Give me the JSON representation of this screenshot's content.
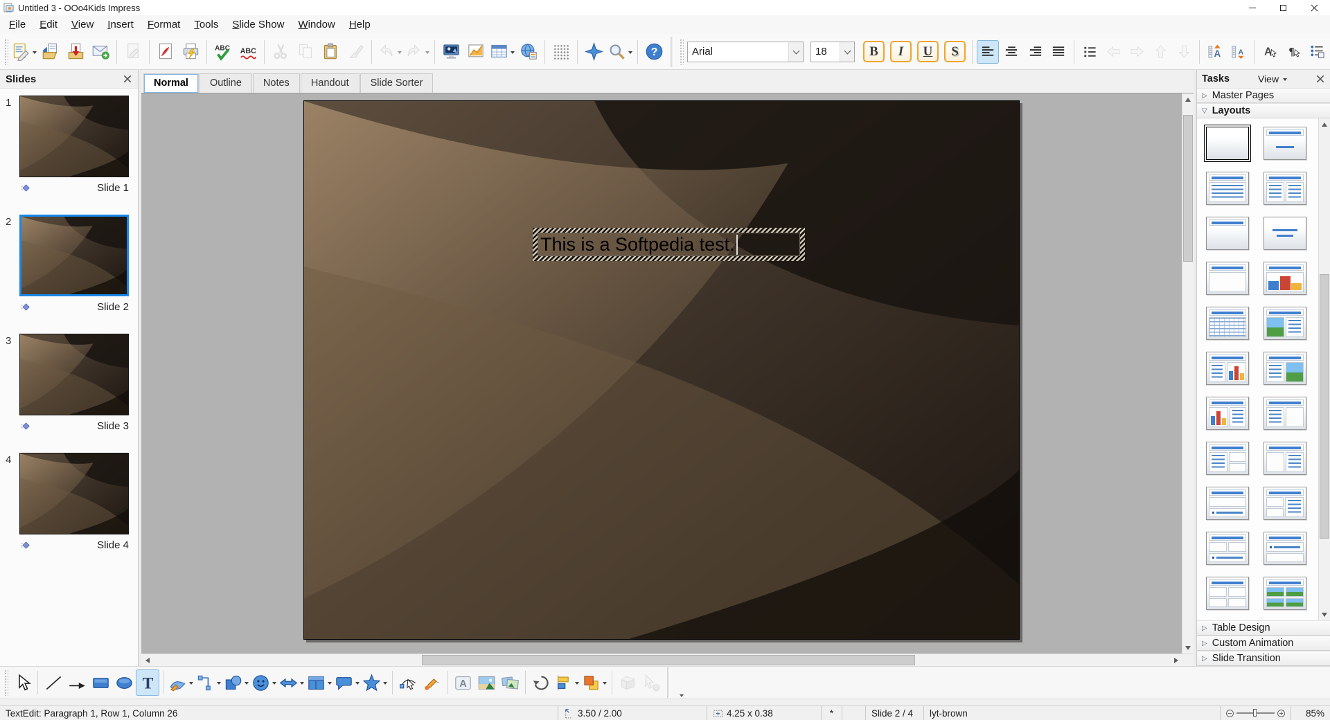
{
  "window": {
    "title": "Untitled 3 - OOo4Kids Impress"
  },
  "menu": {
    "items": [
      "File",
      "Edit",
      "View",
      "Insert",
      "Format",
      "Tools",
      "Slide Show",
      "Window",
      "Help"
    ]
  },
  "main_toolbar": {
    "buttons": [
      {
        "name": "new-presentation",
        "icon": "new-presentation",
        "dropdown": true
      },
      {
        "name": "open",
        "icon": "open"
      },
      {
        "name": "save",
        "icon": "save"
      },
      {
        "name": "send-email",
        "icon": "email"
      },
      {
        "sep": true
      },
      {
        "name": "edit-file",
        "icon": "edit-file",
        "disabled": true
      },
      {
        "sep": true
      },
      {
        "name": "export-pdf",
        "icon": "export-pdf"
      },
      {
        "name": "print",
        "icon": "print"
      },
      {
        "sep": true
      },
      {
        "name": "spellcheck",
        "icon": "spellcheck"
      },
      {
        "name": "auto-spellcheck",
        "icon": "autospellcheck"
      },
      {
        "sep": true
      },
      {
        "name": "cut",
        "icon": "cut",
        "disabled": true
      },
      {
        "name": "copy",
        "icon": "copy",
        "disabled": true
      },
      {
        "name": "paste",
        "icon": "paste"
      },
      {
        "name": "format-paintbrush",
        "icon": "format-paintbrush",
        "disabled": true
      },
      {
        "sep": true
      },
      {
        "name": "undo",
        "icon": "undo",
        "disabled": true,
        "dropdown": true
      },
      {
        "name": "redo",
        "icon": "redo",
        "disabled": true,
        "dropdown": true
      },
      {
        "sep": true
      },
      {
        "name": "display-mode",
        "icon": "display-mode"
      },
      {
        "name": "insert-chart",
        "icon": "insert-chart"
      },
      {
        "name": "insert-table",
        "icon": "insert-table",
        "dropdown": true
      },
      {
        "name": "hyperlink",
        "icon": "hyperlink"
      },
      {
        "sep": true
      },
      {
        "name": "display-grid",
        "icon": "grid"
      },
      {
        "sep": true
      },
      {
        "name": "navigator",
        "icon": "navigator"
      },
      {
        "name": "zoom",
        "icon": "zoom",
        "dropdown": true
      },
      {
        "sep": true
      },
      {
        "name": "help",
        "icon": "help"
      }
    ]
  },
  "format_toolbar": {
    "font_name": "Arial",
    "font_size": "18",
    "buttons": [
      {
        "name": "bold",
        "label": "B",
        "style": "bold",
        "framed": true
      },
      {
        "name": "italic",
        "label": "I",
        "style": "italic",
        "framed": true
      },
      {
        "name": "underline",
        "label": "U",
        "style": "underline",
        "framed": true
      },
      {
        "name": "shadow",
        "label": "S",
        "style": "shadow",
        "framed": true
      },
      {
        "sep": true
      },
      {
        "name": "align-left",
        "icon": "align-left",
        "active": true
      },
      {
        "name": "align-center",
        "icon": "align-center"
      },
      {
        "name": "align-right",
        "icon": "align-right"
      },
      {
        "name": "justify",
        "icon": "justify"
      },
      {
        "sep": true
      },
      {
        "name": "bullets-on-off",
        "icon": "bullets"
      },
      {
        "name": "promote",
        "icon": "arrow-left-outline",
        "disabled": true
      },
      {
        "name": "demote",
        "icon": "arrow-right-outline",
        "disabled": true
      },
      {
        "name": "move-up",
        "icon": "arrow-up-outline",
        "disabled": true
      },
      {
        "name": "move-down",
        "icon": "arrow-down-outline",
        "disabled": true
      },
      {
        "sep": true
      },
      {
        "name": "increase-font",
        "icon": "increase-font"
      },
      {
        "name": "decrease-font",
        "icon": "decrease-font"
      },
      {
        "sep": true
      },
      {
        "name": "character-dialog",
        "icon": "character"
      },
      {
        "name": "paragraph-dialog",
        "icon": "paragraph"
      },
      {
        "name": "bullets-numbering",
        "icon": "bullets-numbering"
      },
      {
        "sep": true
      },
      {
        "name": "font-color",
        "icon": "font-color",
        "framed": true,
        "dropdown": true
      }
    ]
  },
  "view_tabs": {
    "items": [
      {
        "label": "Normal",
        "active": true
      },
      {
        "label": "Outline"
      },
      {
        "label": "Notes"
      },
      {
        "label": "Handout"
      },
      {
        "label": "Slide Sorter"
      }
    ]
  },
  "slides_panel": {
    "title": "Slides",
    "items": [
      {
        "number": "1",
        "label": "Slide 1",
        "selected": false
      },
      {
        "number": "2",
        "label": "Slide 2",
        "selected": true
      },
      {
        "number": "3",
        "label": "Slide 3",
        "selected": false
      },
      {
        "number": "4",
        "label": "Slide 4",
        "selected": false
      }
    ]
  },
  "slide": {
    "text": "This is a Softpedia test."
  },
  "tasks_panel": {
    "title": "Tasks",
    "view_label": "View",
    "sections": [
      {
        "label": "Master Pages",
        "expanded": false
      },
      {
        "label": "Layouts",
        "expanded": true
      }
    ],
    "bottom_sections": [
      {
        "label": "Table Design"
      },
      {
        "label": "Custom Animation"
      },
      {
        "label": "Slide Transition"
      }
    ],
    "layouts": [
      {
        "name": "layout-blank",
        "selected": true,
        "title": false,
        "rows": []
      },
      {
        "name": "layout-title-subtitle",
        "title": true,
        "rows": [
          [
            "subtitle"
          ]
        ]
      },
      {
        "name": "layout-title-bullets",
        "title": true,
        "rows": [
          [
            "bullets"
          ]
        ]
      },
      {
        "name": "layout-title-two-bullets",
        "title": true,
        "rows": [
          [
            "bullets",
            "bullets"
          ]
        ]
      },
      {
        "name": "layout-title-only",
        "title": true,
        "rows": [
          [
            "empty"
          ]
        ]
      },
      {
        "name": "layout-centered-text",
        "title": false,
        "rows": [
          [
            "centerlines"
          ]
        ]
      },
      {
        "name": "layout-title-content",
        "title": true,
        "rows": [
          [
            "box"
          ]
        ]
      },
      {
        "name": "layout-title-chart",
        "title": true,
        "rows": [
          [
            "chart"
          ]
        ]
      },
      {
        "name": "layout-title-table",
        "title": true,
        "rows": [
          [
            "table"
          ]
        ]
      },
      {
        "name": "layout-title-picture-bullets",
        "title": true,
        "rows": [
          [
            "picture",
            "bullets"
          ]
        ]
      },
      {
        "name": "layout-title-bullets-chart",
        "title": true,
        "rows": [
          [
            "bullets",
            "chart"
          ]
        ]
      },
      {
        "name": "layout-title-bullets-picture",
        "title": true,
        "rows": [
          [
            "bullets",
            "picture"
          ]
        ]
      },
      {
        "name": "layout-title-chart-bullets",
        "title": true,
        "rows": [
          [
            "chart",
            "bullets"
          ]
        ]
      },
      {
        "name": "layout-title-bullets-content",
        "title": true,
        "rows": [
          [
            "bullets",
            "box"
          ]
        ]
      },
      {
        "name": "layout-title-bullets-two-content",
        "title": true,
        "rows": [
          [
            "bullets",
            "boxstack"
          ]
        ]
      },
      {
        "name": "layout-title-content-bullets",
        "title": true,
        "rows": [
          [
            "box",
            "bullets"
          ]
        ]
      },
      {
        "name": "layout-title-content-bulletline",
        "title": true,
        "rows": [
          [
            "box"
          ],
          [
            "bulletline"
          ]
        ]
      },
      {
        "name": "layout-title-two-content-bullets",
        "title": true,
        "rows": [
          [
            "boxstack",
            "bullets"
          ]
        ]
      },
      {
        "name": "layout-title-two-boxes-bulletline",
        "title": true,
        "rows": [
          [
            "box",
            "box"
          ],
          [
            "bulletline"
          ]
        ]
      },
      {
        "name": "layout-title-bulletline-content",
        "title": true,
        "rows": [
          [
            "bulletline"
          ],
          [
            "box"
          ]
        ]
      },
      {
        "name": "layout-title-four-content",
        "title": true,
        "rows": [
          [
            "box",
            "box"
          ],
          [
            "box",
            "box"
          ]
        ]
      },
      {
        "name": "layout-title-four-pictures",
        "title": true,
        "rows": [
          [
            "picture",
            "picture"
          ],
          [
            "picture",
            "picture"
          ]
        ]
      }
    ]
  },
  "drawing_toolbar": {
    "buttons": [
      {
        "name": "select",
        "icon": "select"
      },
      {
        "sep": true
      },
      {
        "name": "line",
        "icon": "line"
      },
      {
        "name": "arrow",
        "icon": "arrow-line"
      },
      {
        "name": "rectangle",
        "icon": "rect-shape"
      },
      {
        "name": "ellipse",
        "icon": "ellipse-shape"
      },
      {
        "name": "text",
        "icon": "text-tool",
        "active": true
      },
      {
        "sep": true
      },
      {
        "name": "curve",
        "icon": "curve-tool",
        "dropdown": true
      },
      {
        "name": "connector",
        "icon": "connector-tool",
        "dropdown": true
      },
      {
        "name": "basic-shapes",
        "icon": "basic-shapes",
        "dropdown": true
      },
      {
        "name": "symbol-shapes",
        "icon": "symbol-shapes",
        "dropdown": true
      },
      {
        "name": "block-arrows",
        "icon": "block-arrows",
        "dropdown": true
      },
      {
        "name": "flowchart",
        "icon": "flowchart",
        "dropdown": true
      },
      {
        "name": "callouts",
        "icon": "callouts",
        "dropdown": true
      },
      {
        "name": "stars",
        "icon": "stars",
        "dropdown": true
      },
      {
        "sep": true
      },
      {
        "name": "edit-points",
        "icon": "edit-points"
      },
      {
        "name": "glue-points",
        "icon": "glue-points"
      },
      {
        "sep": true
      },
      {
        "name": "fontwork",
        "icon": "fontwork"
      },
      {
        "name": "insert-picture",
        "icon": "insert-picture"
      },
      {
        "name": "gallery",
        "icon": "gallery"
      },
      {
        "sep": true
      },
      {
        "name": "rotate",
        "icon": "rotate"
      },
      {
        "name": "alignment",
        "icon": "alignment",
        "dropdown": true
      },
      {
        "name": "arrange",
        "icon": "arrange",
        "dropdown": true
      },
      {
        "sep": true
      },
      {
        "name": "extrusion",
        "icon": "extrusion",
        "disabled": true
      },
      {
        "name": "interaction",
        "icon": "interaction",
        "disabled": true
      }
    ]
  },
  "status_bar": {
    "edit_info": "TextEdit: Paragraph 1, Row 1, Column 26",
    "position": "3.50 / 2.00",
    "size": "4.25 x 0.38",
    "modified": "*",
    "slide_indicator": "Slide 2 / 4",
    "template_name": "lyt-brown",
    "zoom_value": "85%"
  }
}
